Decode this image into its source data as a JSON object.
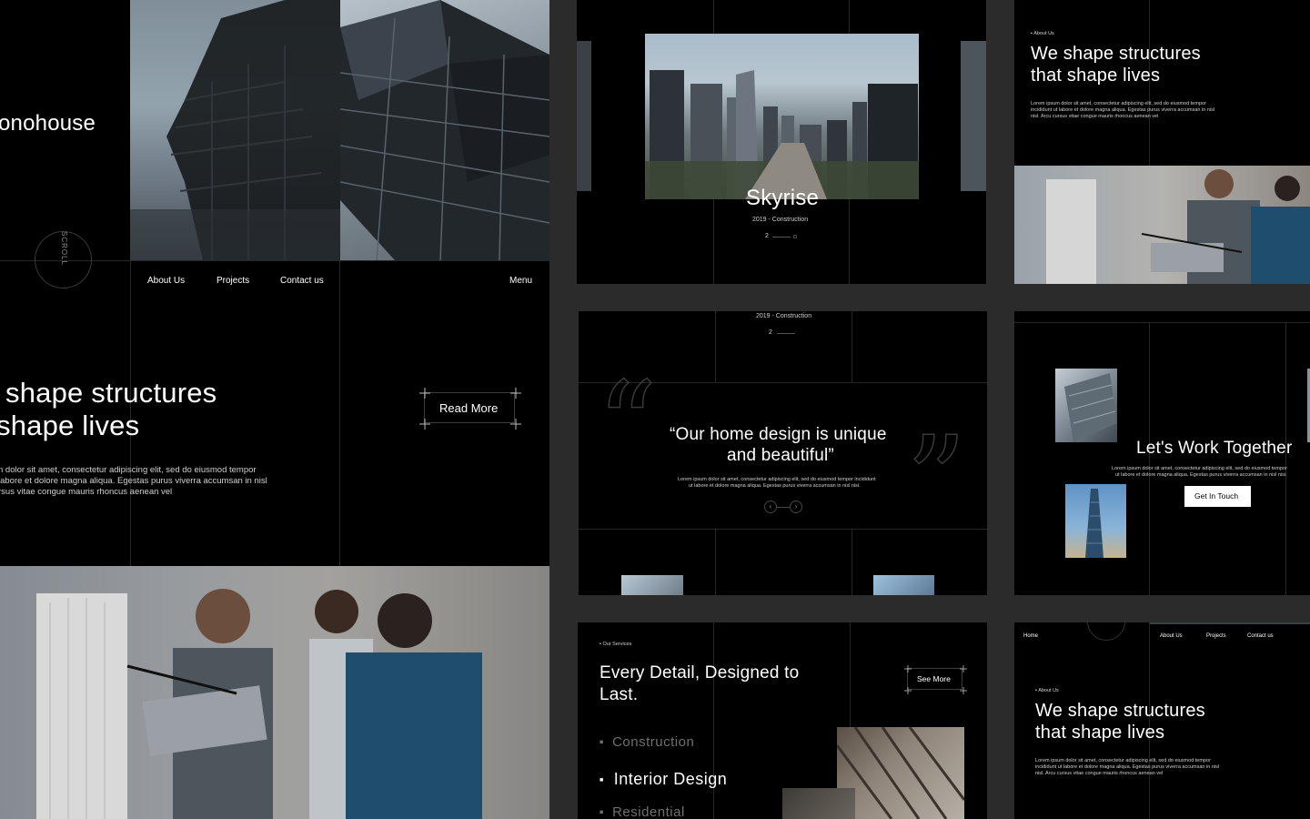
{
  "main_preview": {
    "brand": "onohouse",
    "scroll_label": "SCROLL",
    "nav": [
      "About Us",
      "Projects",
      "Contact us"
    ],
    "menu": "Menu",
    "headline_line1": "shape structures",
    "headline_line2": "shape lives",
    "body_line1": "n dolor sit amet, consectetur adipiscing elit, sed do eiusmod tempor",
    "body_line2": "labore et dolore magna aliqua. Egestas purus viverra accumsan in nisl",
    "body_line3": "rsus vitae congue mauris rhoncus aenean vel",
    "read_more": "Read More"
  },
  "skyrise_card": {
    "title": "Skyrise",
    "subtitle": "2019 - Construction",
    "index": "2"
  },
  "about_card": {
    "eyebrow": "About Us",
    "title_line1": "We shape structures",
    "title_line2": "that shape lives",
    "body_line1": "Lorem ipsum dolor sit amet, consectetur adipiscing elit, sed do eiusmod tempor",
    "body_line2": "incididunt ut labore et dolore magna aliqua. Egestas purus viverra accumsan in nisl",
    "body_line3": "nisl. Arcu cursus vitae congue mauris rhoncus aenean vel"
  },
  "quote_card": {
    "top_subtitle": "2019 - Construction",
    "top_index": "2",
    "quote_line1": "“Our home design is unique",
    "quote_line2": "and beautiful”",
    "body_line1": "Lorem ipsum dolor sit amet, consectetur adipiscing elit, sed do eiusmod tempor incididunt",
    "body_line2": "ut labore et dolore magna aliqua. Egestas purus viverra accumsan in nisl nisi."
  },
  "contact_card": {
    "title": "Let's Work Together",
    "body_line1": "Lorem ipsum dolor sit amet, consectetur adipiscing elit, sed do eiusmod tempor",
    "body_line2": "ut labore et dolore magna aliqua. Egestas purus viverra accumsan in nisl nisi.",
    "button": "Get In Touch"
  },
  "services_card": {
    "eyebrow": "Our Services",
    "title_line1": "Every Detail, Designed to",
    "title_line2": "Last.",
    "see_more": "See More",
    "services": [
      "Construction",
      "Interior Design",
      "Residential"
    ]
  },
  "home_card": {
    "nav_home": "Home",
    "nav": [
      "About Us",
      "Projects",
      "Contact us"
    ],
    "eyebrow": "About Us",
    "title_line1": "We shape structures",
    "title_line2": "that shape lives",
    "body_line1": "Lorem ipsum dolor sit amet, consectetur adipiscing elit, sed do eiusmod tempor",
    "body_line2": "incididunt ut labore et dolore magna aliqua. Egestas purus viverra accumsan in nisl",
    "body_line3": "nisl. Arcu cursus vitae congue mauris rhoncus aenean vel"
  },
  "colors": {
    "background": "#2b2b2b",
    "panel": "#000000",
    "grid_line": "#262626",
    "text": "#ffffff",
    "muted_text": "#6f6f6f"
  }
}
